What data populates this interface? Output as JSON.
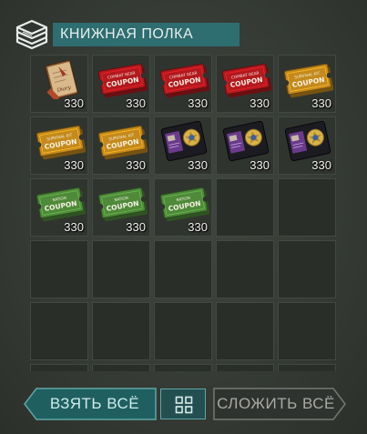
{
  "header": {
    "title": "КНИЖНАЯ ПОЛКА",
    "icon": "books-stack-icon"
  },
  "inventory": {
    "rows": 6,
    "columns": 5,
    "items": [
      {
        "name": "diary-item",
        "type": "diary",
        "count": "330",
        "label": "Diary"
      },
      {
        "name": "combat-gear-coupon-item",
        "type": "coupon",
        "color": "#b3191e",
        "count": "330",
        "label_top": "COMBAT GEAR",
        "label_main": "COUPON"
      },
      {
        "name": "combat-gear-coupon-item",
        "type": "coupon",
        "color": "#b3191e",
        "count": "330",
        "label_top": "COMBAT GEAR",
        "label_main": "COUPON"
      },
      {
        "name": "combat-gear-coupon-item",
        "type": "coupon",
        "color": "#b3191e",
        "count": "330",
        "label_top": "COMBAT GEAR",
        "label_main": "COUPON"
      },
      {
        "name": "survival-kit-coupon-item",
        "type": "coupon",
        "color": "#c48a1c",
        "count": "330",
        "label_top": "SURVIVAL KIT",
        "label_main": "COUPON"
      },
      {
        "name": "survival-kit-coupon-item",
        "type": "coupon",
        "color": "#c48a1c",
        "count": "330",
        "label_top": "SURVIVAL KIT",
        "label_main": "COUPON"
      },
      {
        "name": "survival-kit-coupon-item",
        "type": "coupon",
        "color": "#c48a1c",
        "count": "330",
        "label_top": "SURVIVAL KIT",
        "label_main": "COUPON"
      },
      {
        "name": "badge-wallet-item",
        "type": "badge",
        "count": "330"
      },
      {
        "name": "badge-wallet-item",
        "type": "badge",
        "count": "330"
      },
      {
        "name": "badge-wallet-item",
        "type": "badge",
        "count": "330"
      },
      {
        "name": "ration-coupon-item",
        "type": "coupon",
        "color": "#4f8a3a",
        "count": "330",
        "label_top": "RATION",
        "label_main": "COUPON"
      },
      {
        "name": "ration-coupon-item",
        "type": "coupon",
        "color": "#4f8a3a",
        "count": "330",
        "label_top": "RATION",
        "label_main": "COUPON"
      },
      {
        "name": "ration-coupon-item",
        "type": "coupon",
        "color": "#4f8a3a",
        "count": "330",
        "label_top": "RATION",
        "label_main": "COUPON"
      }
    ]
  },
  "buttons": {
    "take_all": "ВЗЯТЬ ВСЁ",
    "view_toggle_icon": "grid-view-icon",
    "put_all": "СЛОЖИТЬ ВСЁ"
  },
  "colors": {
    "accent": "#2e6d70",
    "take_button": "#1f5f60",
    "take_button_border": "#5fa6a3",
    "put_button_border": "#777873"
  }
}
